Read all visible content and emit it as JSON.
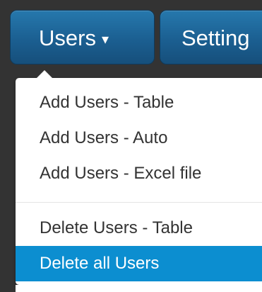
{
  "nav": {
    "users_label": "Users",
    "users_caret": "▾",
    "settings_label": "Setting"
  },
  "dropdown": {
    "items": [
      {
        "label": "Add Users - Table"
      },
      {
        "label": "Add Users - Auto"
      },
      {
        "label": "Add Users - Excel file"
      },
      {
        "label": "Delete Users - Table"
      },
      {
        "label": "Delete all Users"
      }
    ],
    "active_index": 4
  },
  "colors": {
    "nav_blue": "#1b5f91",
    "highlight": "#0c8ed0"
  }
}
